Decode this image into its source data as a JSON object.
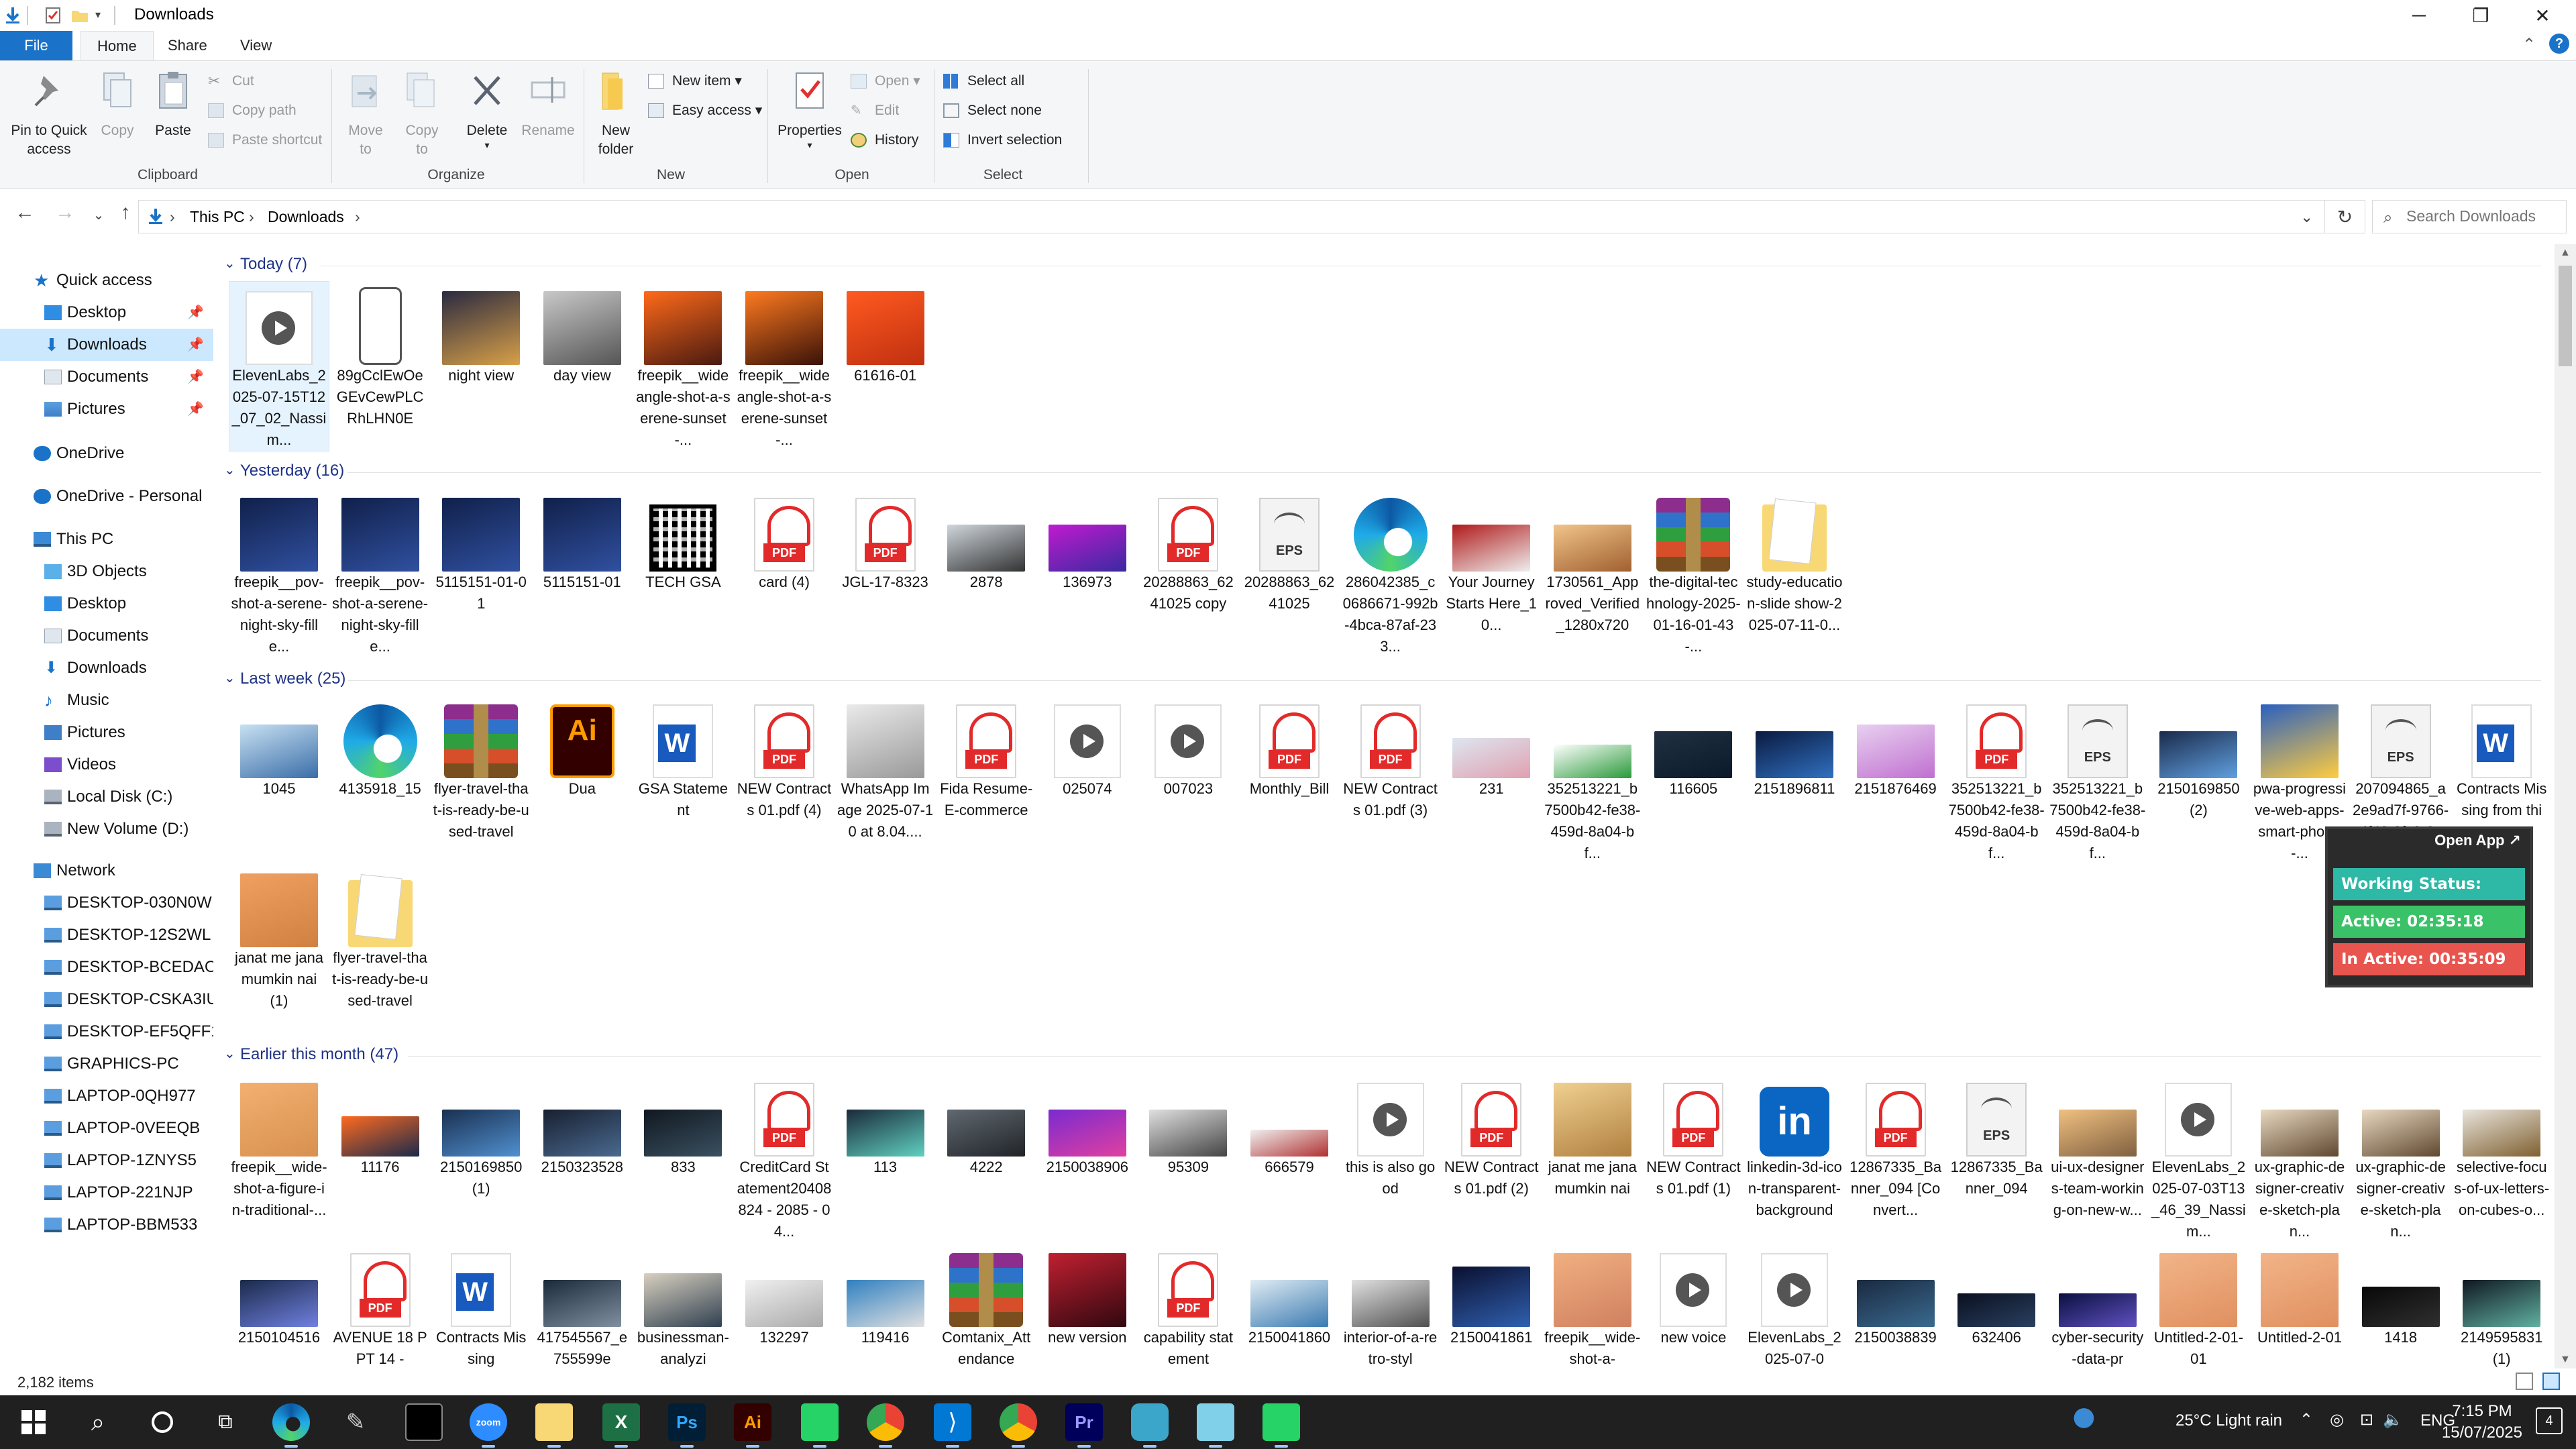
{
  "window": {
    "title": "Downloads"
  },
  "ribbon": {
    "tabs": [
      {
        "label": "File"
      },
      {
        "label": "Home"
      },
      {
        "label": "Share"
      },
      {
        "label": "View"
      }
    ],
    "clipboard": {
      "label": "Clipboard",
      "pin_label": "Pin to Quick\naccess",
      "copy_label": "Copy",
      "paste_label": "Paste",
      "cut_label": "Cut",
      "copy_path_label": "Copy path",
      "paste_shortcut_label": "Paste shortcut"
    },
    "organize": {
      "label": "Organize",
      "move_to_label": "Move\nto",
      "copy_to_label": "Copy\nto",
      "delete_label": "Delete",
      "rename_label": "Rename"
    },
    "new": {
      "label": "New",
      "new_folder_label": "New\nfolder",
      "new_item_label": "New item",
      "easy_access_label": "Easy access"
    },
    "open": {
      "label": "Open",
      "properties_label": "Properties",
      "open_label": "Open",
      "edit_label": "Edit",
      "history_label": "History"
    },
    "select": {
      "label": "Select",
      "select_all_label": "Select all",
      "select_none_label": "Select none",
      "invert_label": "Invert selection"
    }
  },
  "address": {
    "crumbs": [
      "This PC",
      "Downloads"
    ],
    "search_placeholder": "Search Downloads"
  },
  "nav": {
    "quick_access": "Quick access",
    "quick_items": [
      "Desktop",
      "Downloads",
      "Documents",
      "Pictures"
    ],
    "onedrive": "OneDrive",
    "onedrive_personal": "OneDrive - Personal",
    "this_pc": "This PC",
    "pc_items": [
      "3D Objects",
      "Desktop",
      "Documents",
      "Downloads",
      "Music",
      "Pictures",
      "Videos",
      "Local Disk (C:)",
      "New Volume (D:)"
    ],
    "network": "Network",
    "network_items": [
      "DESKTOP-030N0W",
      "DESKTOP-12S2WL",
      "DESKTOP-BCEDAOC",
      "DESKTOP-CSKA3IU",
      "DESKTOP-EF5QFF1",
      "GRAPHICS-PC",
      "LAPTOP-0QH977",
      "LAPTOP-0VEEQB",
      "LAPTOP-1ZNYS5",
      "LAPTOP-221NJP",
      "LAPTOP-BBM533"
    ]
  },
  "groups": {
    "today": "Today (7)",
    "yesterday": "Yesterday (16)",
    "last_week": "Last week (25)",
    "this_month": "Earlier this month (47)"
  },
  "files": {
    "today": [
      "ElevenLabs_2025-07-15T12_07_02_Nassim...",
      "89gCclEwOeGEvCewPLCRhLHN0E",
      "night view",
      "day view",
      "freepik__wideangle-shot-a-serene-sunset-...",
      "freepik__wideangle-shot-a-serene-sunset-...",
      "61616-01"
    ],
    "yesterday": [
      "freepik__pov-shot-a-serene-night-sky-fille...",
      "freepik__pov-shot-a-serene-night-sky-fille...",
      "5115151-01-01",
      "5115151-01",
      "TECH GSA",
      "card (4)",
      "JGL-17-8323",
      "2878",
      "136973",
      "20288863_6241025 copy",
      "20288863_6241025",
      "286042385_c0686671-992b-4bca-87af-233...",
      "Your Journey Starts Here_10...",
      "1730561_Approved_Verified_1280x720",
      "the-digital-technology-2025-01-16-01-43-...",
      "study-education-slide show-2025-07-11-0..."
    ],
    "last_week": [
      "1045",
      "4135918_15",
      "flyer-travel-that-is-ready-be-used-travel",
      "Dua",
      "GSA Statement",
      "NEW Contracts 01.pdf (4)",
      "WhatsApp Image 2025-07-10 at 8.04....",
      "Fida Resume-E-commerce",
      "025074",
      "007023",
      "Monthly_Bill",
      "NEW Contracts 01.pdf (3)",
      "231",
      "352513221_b7500b42-fe38-459d-8a04-bf...",
      "116605",
      "2151896811",
      "2151876469",
      "352513221_b7500b42-fe38-459d-8a04-bf...",
      "352513221_b7500b42-fe38-459d-8a04-bf...",
      "2150169850 (2)",
      "pwa-progressive-web-apps-smart-phone-...",
      "207094865_a2e9ad7f-9766-4f43-8fc8-3cb...",
      "Contracts Missing from this...",
      "janat me jana mumkin nai (1)",
      "flyer-travel-that-is-ready-be-used-travel"
    ],
    "this_month_row1": [
      "freepik__wide-shot-a-figure-in-traditional-...",
      "11176",
      "2150169850 (1)",
      "2150323528",
      "833",
      "CreditCard Statement20408824 - 2085 - 04...",
      "113",
      "4222",
      "2150038906",
      "95309",
      "666579",
      "this is also good",
      "NEW Contracts 01.pdf (2)",
      "janat me jana mumkin nai",
      "NEW Contracts 01.pdf (1)",
      "linkedin-3d-icon-transparent-background",
      "12867335_Banner_094 [Convert...",
      "12867335_Banner_094",
      "ui-ux-designers-team-working-on-new-w...",
      "ElevenLabs_2025-07-03T13_46_39_Nassim...",
      "ux-graphic-designer-creative-sketch-plan...",
      "ux-graphic-designer-creative-sketch-plan...",
      "selective-focus-of-ux-letters-on-cubes-o..."
    ],
    "this_month_row2": [
      "2150104516",
      "AVENUE 18 PPT 14 -",
      "Contracts Missing",
      "417545567_e755599e",
      "businessman-analyzi",
      "132297",
      "119416",
      "Comtanix_Attendance",
      "new version",
      "capability statement",
      "2150041860",
      "interior-of-a-retro-styl",
      "2150041861",
      "freepik__wide-shot-a-",
      "new voice",
      "ElevenLabs_2025-07-0",
      "2150038839",
      "632406",
      "cyber-security-data-pr",
      "Untitled-2-01-01",
      "Untitled-2-01",
      "1418",
      "2149595831 (1)"
    ]
  },
  "overlay": {
    "open_app": "Open App ↗",
    "working_status": "Working Status: Active",
    "active": "Active: 02:35:18",
    "inactive": "In Active: 00:35:09",
    "colors": {
      "working": "#2eb8a6",
      "active": "#39c267",
      "inactive": "#e8554e"
    }
  },
  "status": {
    "item_count": "2,182 items"
  },
  "taskbar": {
    "weather": "25°C  Light rain",
    "lang": "ENG",
    "time": "7:15 PM",
    "date": "15/07/2025",
    "notif_count": "4"
  },
  "colors": {
    "accent": "#1a73c8",
    "selected": "#cce8ff",
    "group_heading": "#1e3287"
  }
}
